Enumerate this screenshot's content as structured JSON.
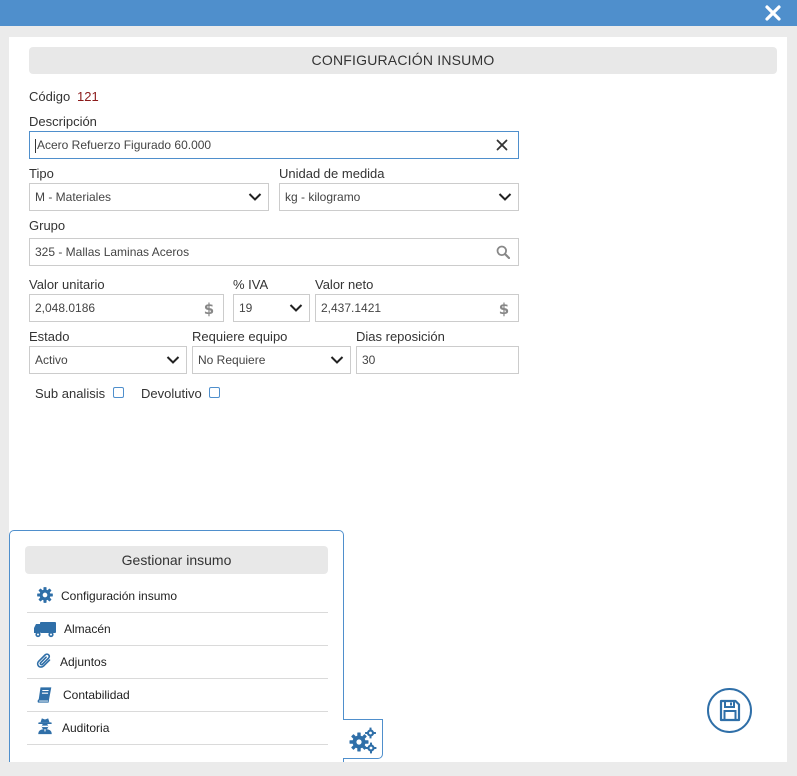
{
  "form": {
    "title": "CONFIGURACIÓN INSUMO",
    "codigo_label": "Código",
    "codigo_value": "121",
    "descripcion_label": "Descripción",
    "descripcion_value": "Acero Refuerzo Figurado 60.000",
    "tipo_label": "Tipo",
    "tipo_value": "M - Materiales",
    "unidad_label": "Unidad de medida",
    "unidad_value": "kg - kilogramo",
    "grupo_label": "Grupo",
    "grupo_value": "325 - Mallas Laminas Aceros",
    "valor_unitario_label": "Valor unitario",
    "valor_unitario_value": "2,048.0186",
    "iva_label": "% IVA",
    "iva_value": "19",
    "valor_neto_label": "Valor neto",
    "valor_neto_value": "2,437.1421",
    "estado_label": "Estado",
    "estado_value": "Activo",
    "requiere_label": "Requiere equipo",
    "requiere_value": "No Requiere",
    "dias_label": "Dias reposición",
    "dias_value": "30",
    "sub_analisis_label": "Sub analisis",
    "devolutivo_label": "Devolutivo"
  },
  "menu": {
    "title": "Gestionar insumo",
    "items": [
      {
        "label": "Configuración insumo",
        "icon": "gear-icon"
      },
      {
        "label": "Almacén",
        "icon": "truck-icon"
      },
      {
        "label": "Adjuntos",
        "icon": "paperclip-icon"
      },
      {
        "label": "Contabilidad",
        "icon": "book-icon"
      },
      {
        "label": "Auditoria",
        "icon": "user-secret-icon"
      }
    ]
  },
  "colors": {
    "titlebar": "#4f8fcc",
    "accent": "#4f8fcc",
    "codigo": "#8b1a1a",
    "save_button": "#2f6fa8"
  }
}
